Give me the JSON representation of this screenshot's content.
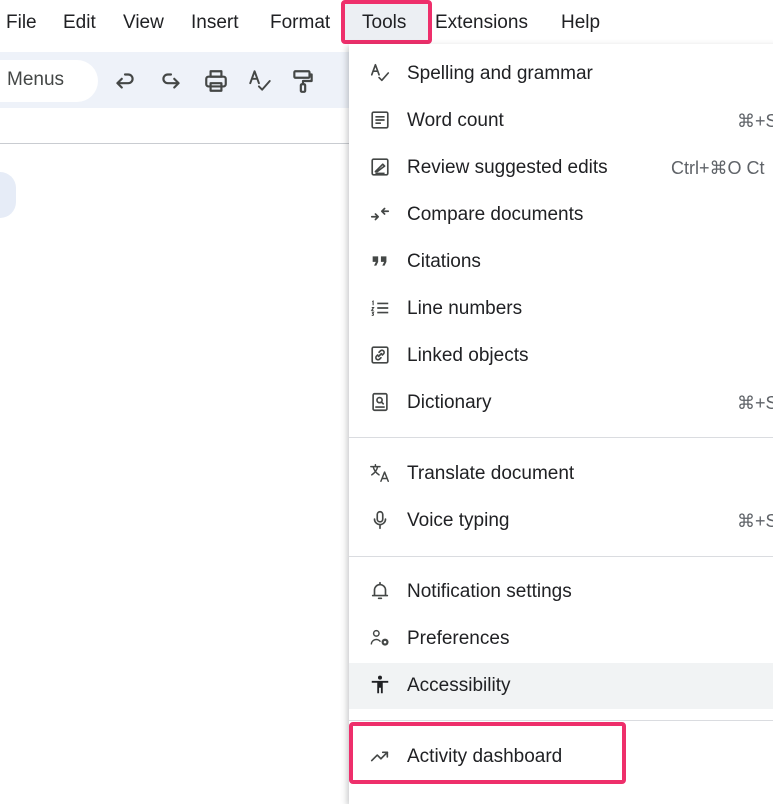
{
  "menubar": {
    "items": [
      {
        "label": "File"
      },
      {
        "label": "Edit"
      },
      {
        "label": "View"
      },
      {
        "label": "Insert"
      },
      {
        "label": "Format"
      },
      {
        "label": "Tools"
      },
      {
        "label": "Extensions"
      },
      {
        "label": "Help"
      }
    ],
    "active": "Tools"
  },
  "toolbar": {
    "menus_label": "Menus",
    "icons": [
      "undo-icon",
      "redo-icon",
      "print-icon",
      "spellcheck-icon",
      "paint-format-icon"
    ]
  },
  "dropdown": {
    "items": [
      {
        "label": "Spelling and grammar",
        "icon": "spellcheck-icon",
        "shortcut": ""
      },
      {
        "label": "Word count",
        "icon": "word-count-icon",
        "shortcut": "⌘+S"
      },
      {
        "label": "Review suggested edits",
        "icon": "review-edits-icon",
        "shortcut": "Ctrl+⌘O Ct"
      },
      {
        "label": "Compare documents",
        "icon": "compare-icon",
        "shortcut": ""
      },
      {
        "label": "Citations",
        "icon": "quote-icon",
        "shortcut": ""
      },
      {
        "label": "Line numbers",
        "icon": "line-numbers-icon",
        "shortcut": ""
      },
      {
        "label": "Linked objects",
        "icon": "link-icon",
        "shortcut": ""
      },
      {
        "label": "Dictionary",
        "icon": "dictionary-icon",
        "shortcut": "⌘+S"
      },
      {
        "label": "Translate document",
        "icon": "translate-icon",
        "shortcut": ""
      },
      {
        "label": "Voice typing",
        "icon": "microphone-icon",
        "shortcut": "⌘+S"
      },
      {
        "label": "Notification settings",
        "icon": "bell-icon",
        "shortcut": ""
      },
      {
        "label": "Preferences",
        "icon": "preferences-icon",
        "shortcut": ""
      },
      {
        "label": "Accessibility",
        "icon": "accessibility-icon",
        "shortcut": "",
        "hovered": true
      },
      {
        "label": "Activity dashboard",
        "icon": "trending-up-icon",
        "shortcut": "",
        "highlighted": true
      }
    ]
  },
  "colors": {
    "highlight_border": "#ee2f6b",
    "toolbar_bg": "#eef2f9",
    "hover_bg": "#f1f3f4"
  }
}
